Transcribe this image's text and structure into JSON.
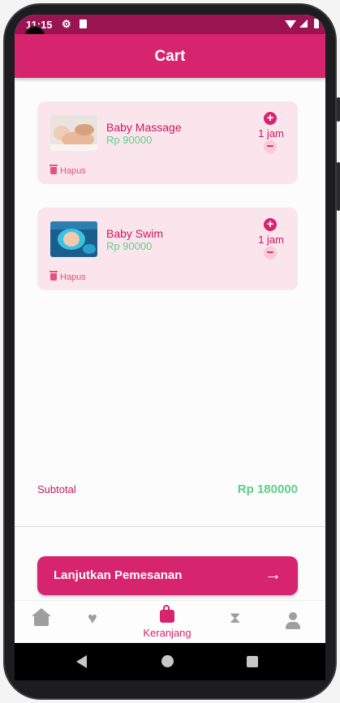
{
  "status_bar": {
    "time": "11:15",
    "icons": [
      "gear-icon",
      "sd-card-icon",
      "wifi-icon",
      "signal-icon",
      "battery-icon"
    ]
  },
  "app_bar": {
    "title": "Cart"
  },
  "cart": {
    "items": [
      {
        "name": "Baby Massage",
        "price": "Rp 90000",
        "qty": "1 jam",
        "delete_label": "Hapus",
        "image": "baby-massage-photo"
      },
      {
        "name": "Baby Swim",
        "price": "Rp 90000",
        "qty": "1 jam",
        "delete_label": "Hapus",
        "image": "baby-swim-photo"
      }
    ],
    "plus_symbol": "+",
    "minus_symbol": "−"
  },
  "summary": {
    "subtotal_label": "Subtotal",
    "subtotal_value": "Rp 180000"
  },
  "cta": {
    "label": "Lanjutkan Pemesanan",
    "arrow": "→"
  },
  "bottom_nav": {
    "items": [
      {
        "icon": "home-icon",
        "label": ""
      },
      {
        "icon": "heart-icon",
        "label": ""
      },
      {
        "icon": "shopping-bag-icon",
        "label": "Keranjang",
        "active": true
      },
      {
        "icon": "hourglass-icon",
        "label": ""
      },
      {
        "icon": "person-icon",
        "label": ""
      }
    ]
  },
  "colors": {
    "primary": "#d6246e",
    "accent_green": "#5fce8a",
    "card_bg": "#fbe5ec",
    "status_bar": "#9b1452"
  }
}
